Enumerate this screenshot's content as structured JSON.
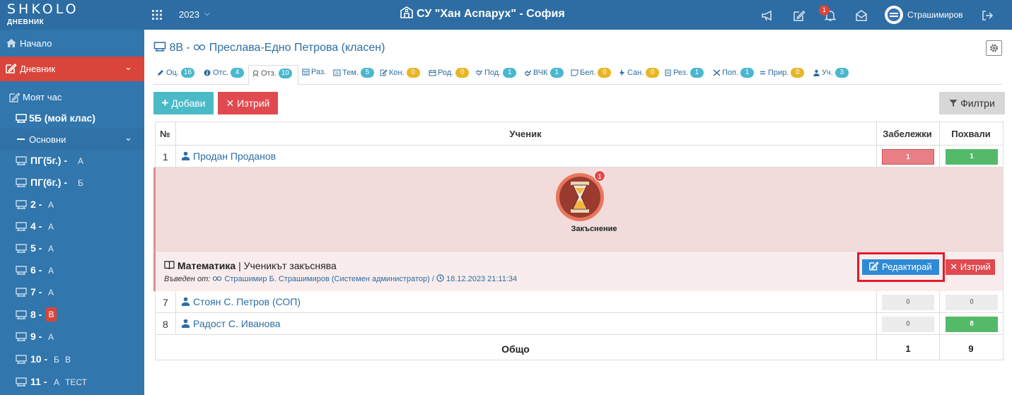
{
  "topbar": {
    "logo_word": "SHKOLO",
    "logo_sub": "ДНЕВНИК",
    "year": "2023",
    "school": "СУ \"Хан Аспарух\" - София",
    "notifications_count": "1",
    "user_name": "Страшимиров",
    "colors": {
      "bar": "#2d6da3",
      "badge": "#d9453a"
    }
  },
  "sidebar": {
    "home": "Начало",
    "diary": "Дневник",
    "my_hour": "Моят час",
    "my_class": "5Б (мой клас)",
    "main_group": "Основни",
    "classes": [
      {
        "name": "ПГ(5г.) -",
        "sections": [
          "А"
        ]
      },
      {
        "name": "ПГ(6г.) -",
        "sections": [
          "Б"
        ]
      },
      {
        "name": "2 -",
        "sections": [
          "А"
        ]
      },
      {
        "name": "4 -",
        "sections": [
          "А"
        ]
      },
      {
        "name": "5 -",
        "sections": [
          "А"
        ]
      },
      {
        "name": "6 -",
        "sections": [
          "А"
        ]
      },
      {
        "name": "7 -",
        "sections": [
          "А"
        ]
      },
      {
        "name": "8 -",
        "sections": [
          "В"
        ],
        "active": "В"
      },
      {
        "name": "9 -",
        "sections": [
          "А"
        ]
      },
      {
        "name": "10 -",
        "sections": [
          "Б",
          "В"
        ]
      },
      {
        "name": "11 -",
        "sections": [
          "А",
          "ТЕСТ"
        ]
      }
    ]
  },
  "main": {
    "title_class": "8В -",
    "title_teacher": "Преслава-Едно Петрова (класен)",
    "tabs": [
      {
        "label": "Оц.",
        "count": "16",
        "color": "b"
      },
      {
        "label": "Отс.",
        "count": "4",
        "color": "b"
      },
      {
        "label": "Отз.",
        "count": "10",
        "color": "b",
        "active": true
      },
      {
        "label": "Раз.",
        "count": "",
        "color": "b"
      },
      {
        "label": "Тем.",
        "count": "5",
        "color": "b"
      },
      {
        "label": "Кон.",
        "count": "0",
        "color": "y"
      },
      {
        "label": "Род.",
        "count": "0",
        "color": "y"
      },
      {
        "label": "Под.",
        "count": "1",
        "color": "b"
      },
      {
        "label": "ВЧК",
        "count": "1",
        "color": "b"
      },
      {
        "label": "Бел.",
        "count": "0",
        "color": "y"
      },
      {
        "label": "Сан.",
        "count": "0",
        "color": "y"
      },
      {
        "label": "Рез.",
        "count": "1",
        "color": "b"
      },
      {
        "label": "Поп.",
        "count": "1",
        "color": "b"
      },
      {
        "label": "Прир.",
        "count": "0",
        "color": "y"
      },
      {
        "label": "Уч.",
        "count": "3",
        "color": "b"
      }
    ],
    "add_label": "Добави",
    "delete_label": "Изтрий",
    "filter_label": "Филтри"
  },
  "table": {
    "headers": {
      "num": "№",
      "student": "Ученик",
      "remarks": "Забележки",
      "praises": "Похвали"
    },
    "rows": [
      {
        "num": "1",
        "name": "Продан Проданов",
        "remarks": "1",
        "praises": "1"
      },
      {
        "num": "7",
        "name": "Стоян С. Петров (СОП)",
        "remarks": "0",
        "praises": "0"
      },
      {
        "num": "8",
        "name": "Радост С. Иванова",
        "remarks": "0",
        "praises": "8"
      }
    ],
    "detail": {
      "badge": "1",
      "label": "Закъснение",
      "subject": "Математика",
      "separator": "|",
      "text": "Ученикът закъснява",
      "entered_prefix": "Въведен от:",
      "entered_by": "Страшимир Б. Страшимиров (Системен администратор) /",
      "datetime": "18.12.2023 21:11:34",
      "edit_label": "Редактирай",
      "delete_label": "Изтрий"
    },
    "total_label": "Общо",
    "total_remarks": "1",
    "total_praises": "9"
  }
}
